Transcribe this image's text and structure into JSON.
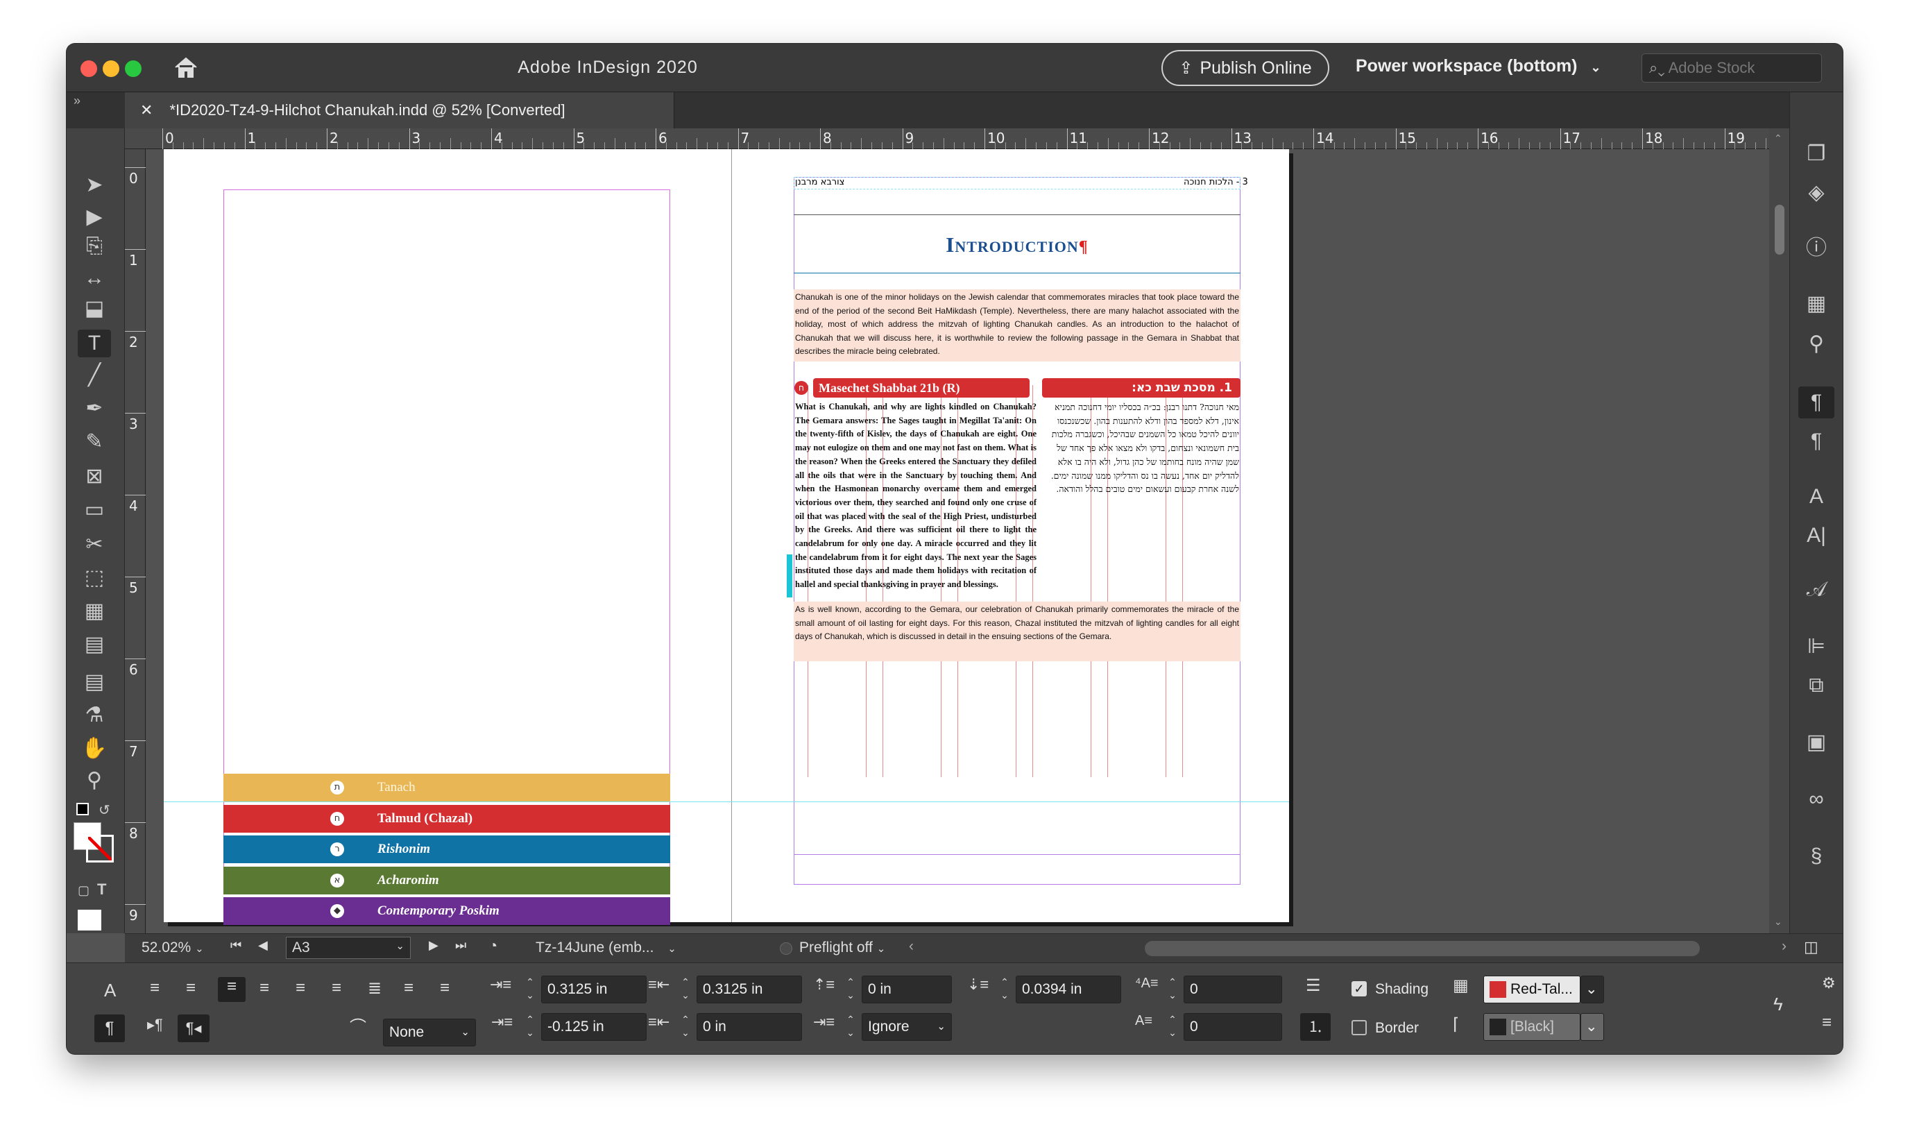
{
  "app": {
    "title": "Adobe InDesign 2020",
    "publish_label": "Publish Online",
    "workspace_label": "Power workspace (bottom)",
    "stock_placeholder": "Adobe Stock",
    "home_icon": "home-icon",
    "panel_toggle": "»",
    "panel_toggle_right": "«"
  },
  "tab": {
    "title": "*ID2020-Tz4-9-Hilchot Chanukah.indd @ 52% [Converted]",
    "close": "✕"
  },
  "ruler": {
    "h": [
      "0",
      "1",
      "2",
      "3",
      "4",
      "5",
      "6",
      "7",
      "8",
      "9",
      "10",
      "11",
      "12",
      "13",
      "14",
      "15",
      "16",
      "17",
      "18",
      "19"
    ],
    "v": [
      "0",
      "1",
      "2",
      "3",
      "4",
      "5",
      "6",
      "7",
      "8",
      "9"
    ]
  },
  "legend": [
    {
      "label": "Tanach",
      "icon": "ת",
      "color": "#e8b654"
    },
    {
      "label": "Talmud (Chazal)",
      "icon": "ח",
      "color": "#d42e30"
    },
    {
      "label": "Rishonim",
      "icon": "ר",
      "color": "#0f73a6"
    },
    {
      "label": "Acharonim",
      "icon": "א",
      "color": "#5a7a34"
    },
    {
      "label": "Contemporary Poskim",
      "icon": "◆",
      "color": "#6a2d91"
    }
  ],
  "page": {
    "header_right": "3 - הלכות חנוכה",
    "header_left": "צורבא מרבנן",
    "title": "Introduction",
    "intro": "Chanukah is one of the minor holidays on the Jewish calendar that commemorates miracles that took place toward the end of the period of the second Beit HaMikdash (Temple). Nevertheless, there are many halachot associated with the holiday, most of which address the mitzvah of lighting Chanukah candles. As an introduction to the halachot of Chanukah that we will discuss here, it is worthwhile to review the following passage in the Gemara in Shabbat that describes the miracle being celebrated.",
    "source_en": "Masechet Shabbat 21b (R)",
    "source_he": "1.   מסכת שבת כא:",
    "source_icon": "ח",
    "english_text": "What is Chanukah, and why are lights kindled on Chanukah? The Gemara answers: The Sages taught in Megillat Ta'anit: On the twenty-fifth of Kislev, the days of Chanukah are eight. One may not eulogize on them and one may not fast on them. What is the reason? When the Greeks entered the Sanctuary they defiled all the oils that were in the Sanctuary by touching them. And when the Hasmonean monarchy overcame them and emerged victorious over them, they searched and found only one cruse of oil that was placed with the seal of the High Priest, undisturbed by the Greeks. And there was sufficient oil there to light the candelabrum for only one day. A miracle occurred and they lit the candelabrum from it for eight days. The next year the Sages instituted those days and made them holidays with recitation of hallel and special thanksgiving in prayer and blessings.",
    "hebrew_text": "מאי חנוכה? דתנו רבנן: בכ״ה בכסליו יומי דחנוכה תמניא אינון, דלא למספד בהון ודלא להתענות בהון. שכשנכנסו יוונים להיכל טמאו כל השמנים שבהיכל, וכשגברה מלכות בית חשמונאי ונצחום, בדקו ולא מצאו אלא פך אחד של שמן שהיה מונח בחותמו של כהן גדול, ולא היה בו אלא להדליק יום אחד, נעשה בו נס והדליקו ממנו שמונה ימים. לשנה אחרת קבעום ועשאום ימים טובים בהלל והודאה.",
    "closing": "As is well known, according to the Gemara, our celebration of Chanukah primarily commemorates the miracle of the small amount of oil lasting for eight days. For this reason, Chazal instituted the mitzvah of lighting candles for all eight days of Chanukah, which is discussed in detail in the ensuing sections of the Gemara."
  },
  "status": {
    "zoom": "52.02%",
    "page": "A3",
    "style": "Tz-14June (emb...",
    "preflight": "Preflight off"
  },
  "control": {
    "left_indent": "0.3125 in",
    "right_indent": "0.3125 in",
    "first_indent": "-0.125 in",
    "last_indent": "0 in",
    "space_before": "0 in",
    "space_after": "0.0394 in",
    "dropcap_lines": "0",
    "dropcap_chars": "0",
    "align_grid": "Ignore",
    "hyphen": "None",
    "shading_label": "Shading",
    "shading_swatch": "Red-Tal...",
    "shading_color": "#d42e30",
    "border_label": "Border",
    "border_swatch": "[Black]"
  }
}
